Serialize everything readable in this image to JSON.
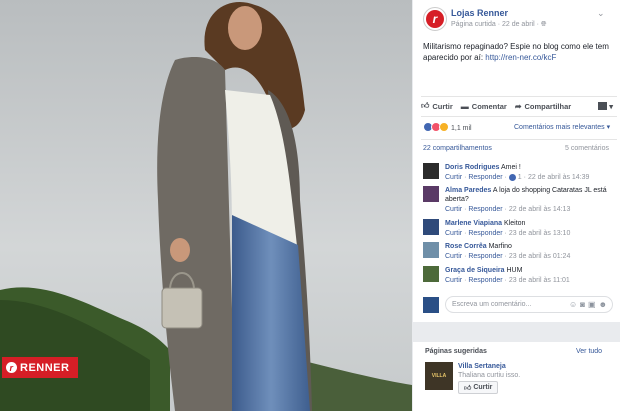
{
  "photo": {
    "brand_badge": "RENNER",
    "brand_badge_letter": "r"
  },
  "post": {
    "page_name": "Lojas Renner",
    "page_avatar_letter": "r",
    "page_sub": "Página curtida · 22 de abril · ",
    "chevron": "⌄",
    "caption_text": "Militarismo repaginado? Espie no blog como ele tem aparecido por aí: ",
    "caption_link": "http://ren-ner.co/kcF"
  },
  "actions": {
    "like": "Curtir",
    "comment": "Comentar",
    "share": "Compartilhar"
  },
  "reactions": {
    "count": "1,1 mil",
    "sort_label": "Comentários mais relevantes ▾"
  },
  "counts": {
    "shares": "22 compartilhamentos",
    "comments": "5 comentários"
  },
  "comments": [
    {
      "name": "Doris Rodrigues",
      "text": "Amei !",
      "meta_like": "Curtir",
      "meta_reply": "Responder",
      "likes": "1",
      "date": "22 de abril às 14:39",
      "avatar_color": "#2b2b2b"
    },
    {
      "name": "Alma Paredes",
      "text": "A loja do shopping Cataratas JL está aberta?",
      "meta_like": "Curtir",
      "meta_reply": "Responder",
      "likes": "",
      "date": "22 de abril às 14:13",
      "avatar_color": "#5a3a66"
    },
    {
      "name": "Marlene Viapiana",
      "text": "Kleiton",
      "meta_like": "Curtir",
      "meta_reply": "Responder",
      "likes": "",
      "date": "23 de abril às 13:10",
      "avatar_color": "#2f4a7a"
    },
    {
      "name": "Rose Corrêa",
      "text": "Marfino",
      "meta_like": "Curtir",
      "meta_reply": "Responder",
      "likes": "",
      "date": "23 de abril às 01:24",
      "avatar_color": "#6f8fa8"
    },
    {
      "name": "Graça de Siqueira",
      "text": "HUM",
      "meta_like": "Curtir",
      "meta_reply": "Responder",
      "likes": "",
      "date": "23 de abril às 11:01",
      "avatar_color": "#4d6a3a"
    }
  ],
  "write": {
    "placeholder": "Escreva um comentário..."
  },
  "suggested": {
    "title": "Páginas sugeridas",
    "see_all": "Ver tudo",
    "thumb_text": "VILLA",
    "name": "Villa Sertaneja",
    "desc": "Thaliana curtiu isso.",
    "button": "Curtir"
  },
  "colors": {
    "brand_red": "#d61e26",
    "link_blue": "#365899",
    "fb_blue": "#4267b2"
  }
}
